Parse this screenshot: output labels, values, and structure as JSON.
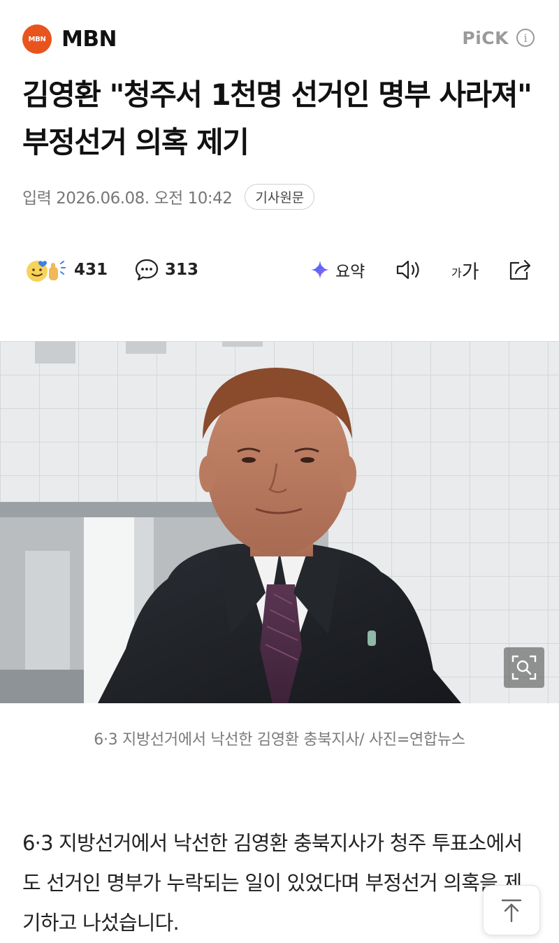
{
  "press": {
    "logo_text": "MBN",
    "name": "MBN",
    "pick_label": "PiCK",
    "info_glyph": "i"
  },
  "article": {
    "headline": "김영환 \"청주서 1천명 선거인 명부 사라져\" 부정선거 의혹 제기",
    "published": "입력 2026.06.08. 오전 10:42",
    "original_link_label": "기사원문"
  },
  "toolbar": {
    "reactions_count": "431",
    "comments_count": "313",
    "summary_label": "요약",
    "font_size_small": "가",
    "font_size_large": "가"
  },
  "photo": {
    "caption": "6·3 지방선거에서 낙선한 김영환 충북지사/ 사진=연합뉴스"
  },
  "body": {
    "paragraph": "6·3 지방선거에서 낙선한 김영환 충북지사가 청주 투표소에서도 선거인 명부가 누락되는 일이 있었다며 부정선거 의혹을 제기하고 나섰습니다."
  },
  "colors": {
    "brand": "#e8541e",
    "muted": "#9a9a9a",
    "text": "#111111"
  }
}
